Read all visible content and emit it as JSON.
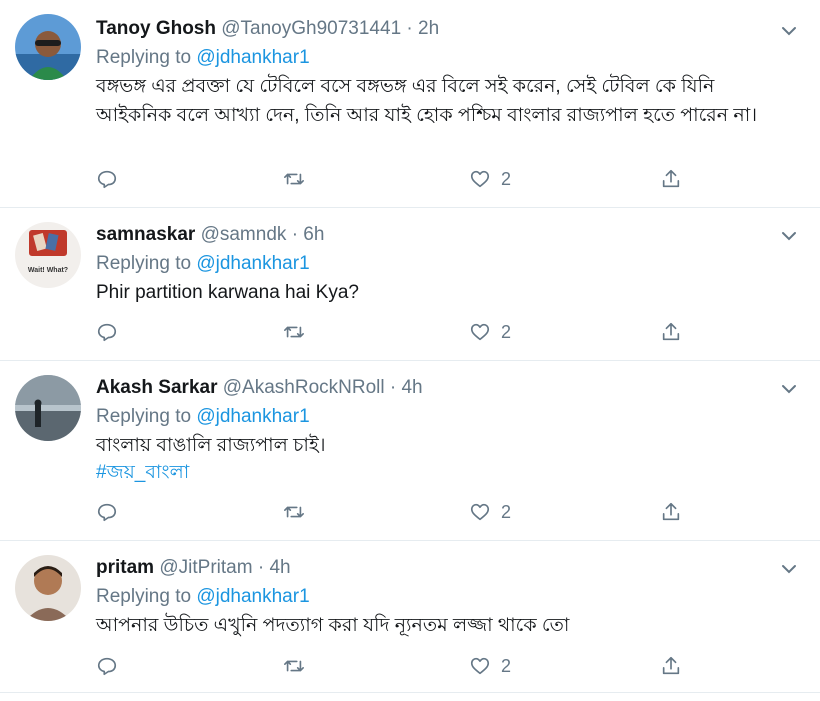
{
  "tweets": [
    {
      "name": "Tanoy Ghosh",
      "handle": "@TanoyGh90731441",
      "dot": "·",
      "time": "2h",
      "replying_prefix": "Replying to ",
      "replying_to": "@jdhankhar1",
      "text": "বঙ্গভঙ্গ এর প্রবক্তা যে টেবিলে বসে বঙ্গভঙ্গ এর বিলে সই করেন, সেই টেবিল কে যিনি আইকনিক বলে আখ্যা দেন, তিনি আর যাই হোক পশ্চিম বাংলার রাজ্যপাল হতে পারেন না।",
      "hashtag": "",
      "likes": "2",
      "avatar_color": "#3a7bbf"
    },
    {
      "name": "samnaskar",
      "handle": "@samndk",
      "dot": "·",
      "time": "6h",
      "replying_prefix": "Replying to ",
      "replying_to": "@jdhankhar1",
      "text": "Phir partition karwana hai Kya?",
      "hashtag": "",
      "likes": "2",
      "avatar_color": "#d8d3cf"
    },
    {
      "name": "Akash Sarkar",
      "handle": "@AkashRockNRoll",
      "dot": "·",
      "time": "4h",
      "replying_prefix": "Replying to ",
      "replying_to": "@jdhankhar1",
      "text": "বাংলায় বাঙালি রাজ্যপাল চাই।",
      "hashtag": "#জয়_বাংলা",
      "likes": "2",
      "avatar_color": "#7a8a96"
    },
    {
      "name": "pritam",
      "handle": "@JitPritam",
      "dot": "·",
      "time": "4h",
      "replying_prefix": "Replying to ",
      "replying_to": "@jdhankhar1",
      "text": "আপনার উচিত এখুনি পদত্যাগ করা যদি ন্যূনতম লজ্জা থাকে তো",
      "hashtag": "",
      "likes": "2",
      "avatar_color": "#c9a78c"
    }
  ],
  "avatar_caption": "Wait! What?",
  "icons": {
    "reply": "reply-icon",
    "retweet": "retweet-icon",
    "like": "heart-icon",
    "share": "share-icon",
    "menu": "chevron-down-icon"
  },
  "colors": {
    "link": "#1b95e0",
    "secondary_text": "#657786",
    "divider": "#e6ecf0"
  }
}
